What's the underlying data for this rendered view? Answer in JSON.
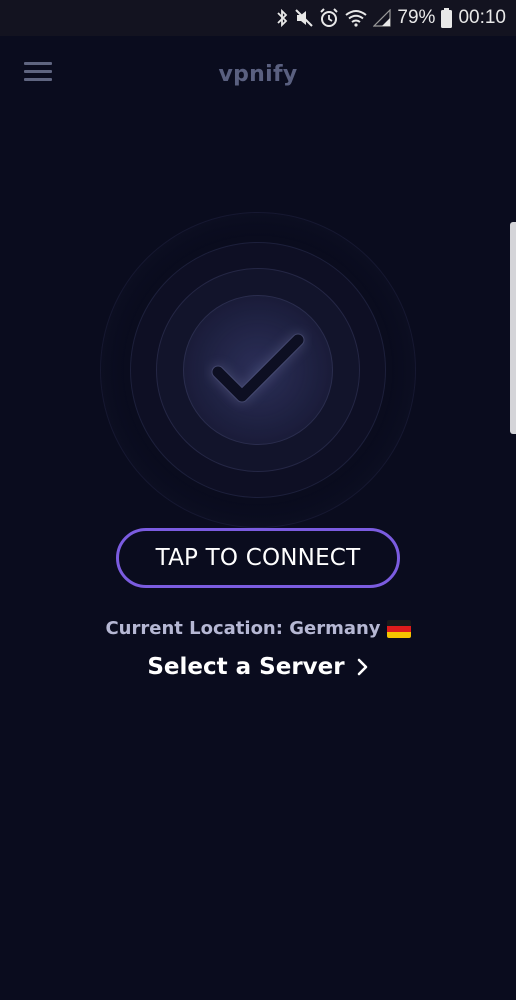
{
  "status_bar": {
    "battery": "79%",
    "time": "00:10",
    "icons": [
      "bluetooth-icon",
      "mute-icon",
      "alarm-icon",
      "wifi-icon",
      "signal-icon",
      "battery-icon"
    ]
  },
  "app_bar": {
    "title": "vpnify",
    "menu_icon": "hamburger-menu-icon"
  },
  "connect": {
    "status_icon": "checkmark-icon",
    "button_label": "TAP TO CONNECT"
  },
  "location": {
    "label": "Current Location: Germany",
    "flag_icon": "germany-flag-icon",
    "select_server_label": "Select a Server",
    "chevron_icon": "chevron-right-icon"
  },
  "colors": {
    "background": "#0a0c1e",
    "accent": "#7b5ce0",
    "title": "#5a6080",
    "location_text": "#b6b8d4"
  }
}
